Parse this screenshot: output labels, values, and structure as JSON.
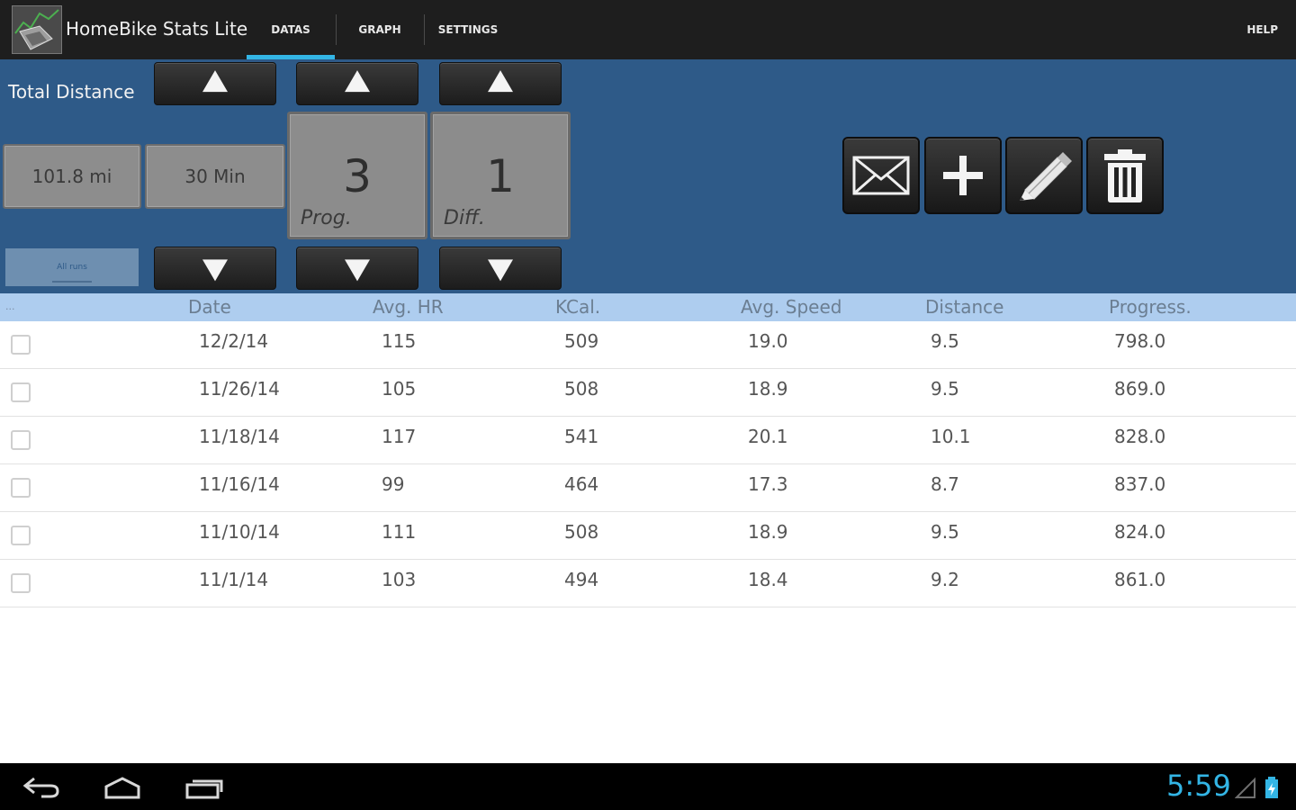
{
  "app": {
    "title": "HomeBike Stats Lite",
    "icon": "app-logo-icon"
  },
  "tabs": [
    {
      "label": "DATAS",
      "active": true
    },
    {
      "label": "GRAPH",
      "active": false
    },
    {
      "label": "SETTINGS",
      "active": false
    }
  ],
  "help_label": "HELP",
  "panel": {
    "total_label": "Total Distance",
    "distance_value": "101.8 mi",
    "duration_value": "30 Min",
    "prog": {
      "value": "3",
      "caption": "Prog."
    },
    "diff": {
      "value": "1",
      "caption": "Diff."
    },
    "all_runs_label": "All runs"
  },
  "tools": [
    "mail-icon",
    "plus-icon",
    "pencil-icon",
    "trash-icon"
  ],
  "table": {
    "header_dots": "...",
    "columns": [
      "Date",
      "Avg. HR",
      "KCal.",
      "Avg. Speed",
      "Distance",
      "Progress."
    ],
    "rows": [
      [
        "12/2/14",
        "115",
        "509",
        "19.0",
        "9.5",
        "798.0"
      ],
      [
        "11/26/14",
        "105",
        "508",
        "18.9",
        "9.5",
        "869.0"
      ],
      [
        "11/18/14",
        "117",
        "541",
        "20.1",
        "10.1",
        "828.0"
      ],
      [
        "11/16/14",
        "99",
        "464",
        "17.3",
        "8.7",
        "837.0"
      ],
      [
        "11/10/14",
        "111",
        "508",
        "18.9",
        "9.5",
        "824.0"
      ],
      [
        "11/1/14",
        "103",
        "494",
        "18.4",
        "9.2",
        "861.0"
      ]
    ]
  },
  "navbar": {
    "clock": "5:59",
    "accent": "#33b5e5"
  },
  "colors": {
    "panel": "#2e5a88",
    "header": "#aecdef",
    "tab_indicator": "#33b5e5"
  }
}
